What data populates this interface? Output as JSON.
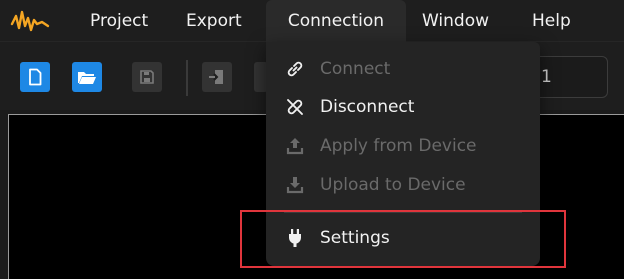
{
  "menubar": {
    "items": [
      {
        "label": "Project"
      },
      {
        "label": "Export"
      },
      {
        "label": "Connection"
      },
      {
        "label": "Window"
      },
      {
        "label": "Help"
      }
    ]
  },
  "toolbar": {
    "zoom_value": "1"
  },
  "connection_menu": {
    "items": [
      {
        "label": "Connect",
        "icon": "link-icon",
        "enabled": false
      },
      {
        "label": "Disconnect",
        "icon": "unlink-icon",
        "enabled": true
      },
      {
        "label": "Apply from Device",
        "icon": "upload-icon",
        "enabled": false
      },
      {
        "label": "Upload to Device",
        "icon": "download-icon",
        "enabled": false
      },
      {
        "label": "Settings",
        "icon": "plug-icon",
        "enabled": true
      }
    ]
  },
  "colors": {
    "accent": "#1e88e5",
    "logo": "#f5a623",
    "highlight": "#e0353c"
  }
}
